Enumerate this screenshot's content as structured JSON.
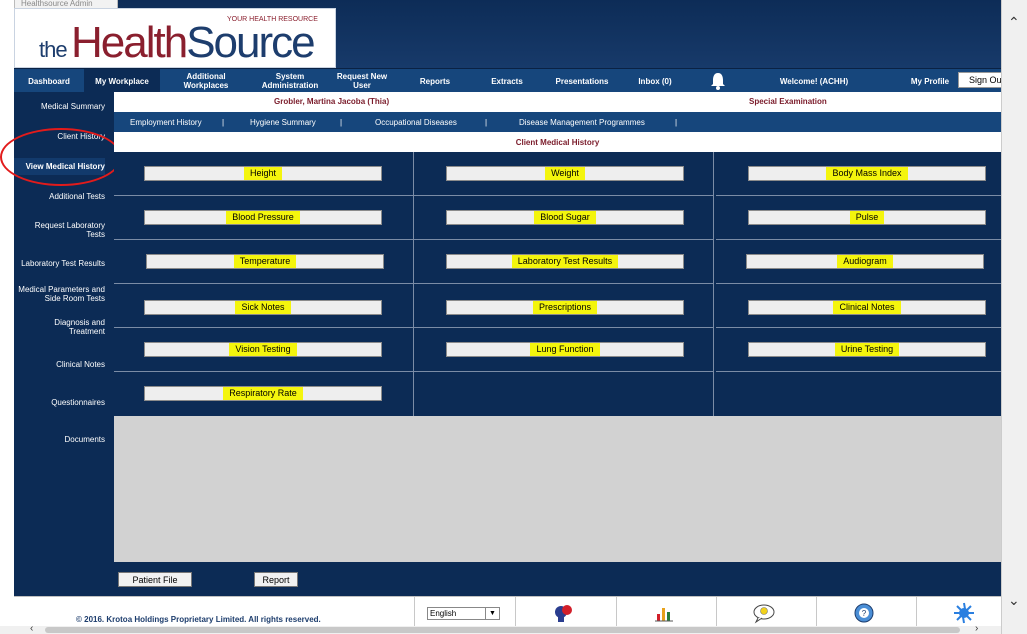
{
  "browser": {
    "tab_label": "Healthsource Admin"
  },
  "logo": {
    "prefix": "the",
    "brand_main": "Health",
    "brand_accent": "Source",
    "tagline": "YOUR HEALTH RESOURCE"
  },
  "nav": {
    "items": [
      "Dashboard",
      "My Workplace",
      "Additional Workplaces",
      "System Administration",
      "Request New User",
      "Reports",
      "Extracts",
      "Presentations",
      "Inbox (0)"
    ],
    "notification_count": "0",
    "welcome": "Welcome! (ACHH)",
    "my_profile": "My Profile",
    "sign_out": "Sign Out",
    "active_index": 1
  },
  "sidebar": {
    "items": [
      "Medical Summary",
      "Client History",
      "View Medical History",
      "Additional Tests",
      "Request Laboratory Tests",
      "Laboratory Test Results",
      "Medical Parameters and Side Room Tests",
      "Diagnosis and Treatment",
      "Clinical Notes",
      "Questionnaires",
      "Documents"
    ],
    "active_index": 2
  },
  "client": {
    "name": "Grobler, Martina Jacoba (Thia)",
    "exam_type": "Special Examination"
  },
  "subnav": {
    "items": [
      "Employment History",
      "Hygiene Summary",
      "Occupational Diseases",
      "Disease Management Programmes"
    ],
    "separator": "|"
  },
  "section": {
    "title": "Client Medical History"
  },
  "history_buttons": [
    "Height",
    "Weight",
    "Body Mass Index",
    "Blood Pressure",
    "Blood Sugar",
    "Pulse",
    "Temperature",
    "Laboratory Test Results",
    "Audiogram",
    "Sick Notes",
    "Prescriptions",
    "Clinical Notes",
    "Vision Testing",
    "Lung Function",
    "Urine Testing",
    "Respiratory Rate"
  ],
  "actions": {
    "patient_file": "Patient File",
    "report": "Report"
  },
  "footer": {
    "copyright": "© 2016. Krotoa Holdings Proprietary Limited. All rights reserved.",
    "language": "English",
    "icons": [
      "boxing-glove-icon",
      "chart-icon",
      "lightbulb-icon",
      "help-icon",
      "splash-icon"
    ]
  },
  "colors": {
    "navy": "#0c2b55",
    "nav_blue": "#16467c",
    "highlight": "#f4f50d",
    "brand_red": "#8a1f2e",
    "annotation_red": "#e21b1b"
  }
}
